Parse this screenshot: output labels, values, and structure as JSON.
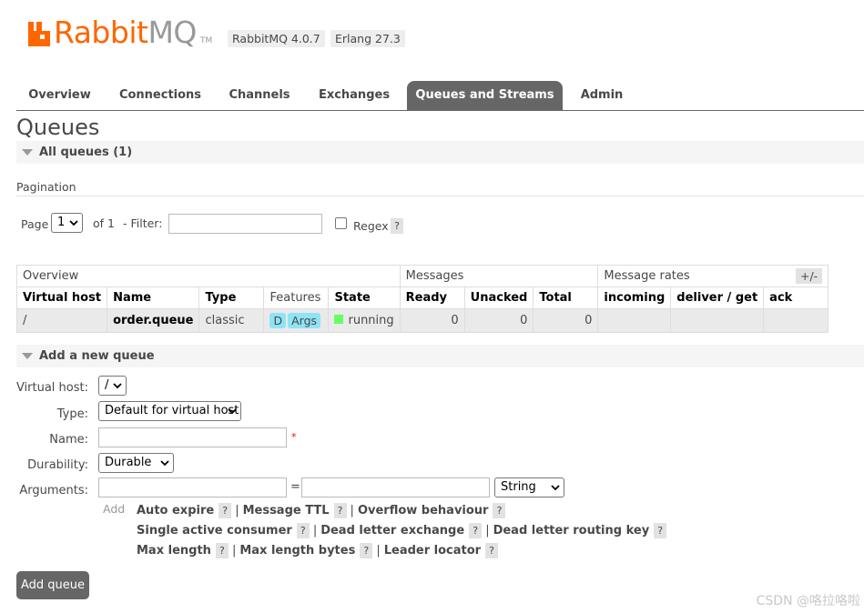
{
  "header": {
    "logo_text_1": "Rabbit",
    "logo_text_2": "MQ",
    "logo_tm": "TM",
    "version_badge": "RabbitMQ 4.0.7",
    "erlang_badge": "Erlang 27.3",
    "brand_color": "#ff6600"
  },
  "tabs": [
    {
      "label": "Overview"
    },
    {
      "label": "Connections"
    },
    {
      "label": "Channels"
    },
    {
      "label": "Exchanges"
    },
    {
      "label": "Queues and Streams",
      "active": true
    },
    {
      "label": "Admin"
    }
  ],
  "page_title": "Queues",
  "all_queues": {
    "label": "All queues (1)"
  },
  "pagination": {
    "label": "Pagination",
    "page_label": "Page",
    "page_value": "1",
    "of_label": "of 1",
    "filter_label": "- Filter:",
    "filter_value": "",
    "regex_label": "Regex",
    "help": "?"
  },
  "table": {
    "groups": [
      "Overview",
      "Messages",
      "Message rates"
    ],
    "columns": [
      "Virtual host",
      "Name",
      "Type",
      "Features",
      "State",
      "Ready",
      "Unacked",
      "Total",
      "incoming",
      "deliver / get",
      "ack"
    ],
    "rows": [
      {
        "virtual_host": "/",
        "name": "order.queue",
        "type": "classic",
        "features": [
          "D",
          "Args"
        ],
        "state": "running",
        "ready": "0",
        "unacked": "0",
        "total": "0",
        "incoming": "",
        "deliver_get": "",
        "ack": ""
      }
    ],
    "plus_minus": "+/-",
    "state_color": "#66ff66",
    "feature_color": "#8ee4f5"
  },
  "add_queue": {
    "section_label": "Add a new queue",
    "virtual_host_label": "Virtual host:",
    "virtual_host_value": "/",
    "type_label": "Type:",
    "type_value": "Default for virtual host",
    "name_label": "Name:",
    "name_value": "",
    "required_mark": "*",
    "durability_label": "Durability:",
    "durability_value": "Durable",
    "arguments_label": "Arguments:",
    "arg_equals": "=",
    "arg_type_value": "String",
    "add_link": "Add",
    "arg_lines": [
      [
        "Auto expire",
        "Message TTL",
        "Overflow behaviour"
      ],
      [
        "Single active consumer",
        "Dead letter exchange",
        "Dead letter routing key"
      ],
      [
        "Max length",
        "Max length bytes",
        "Leader locator"
      ]
    ],
    "separator": "|",
    "help": "?",
    "button_label": "Add queue"
  },
  "watermark": "CSDN @咯拉咯啦"
}
